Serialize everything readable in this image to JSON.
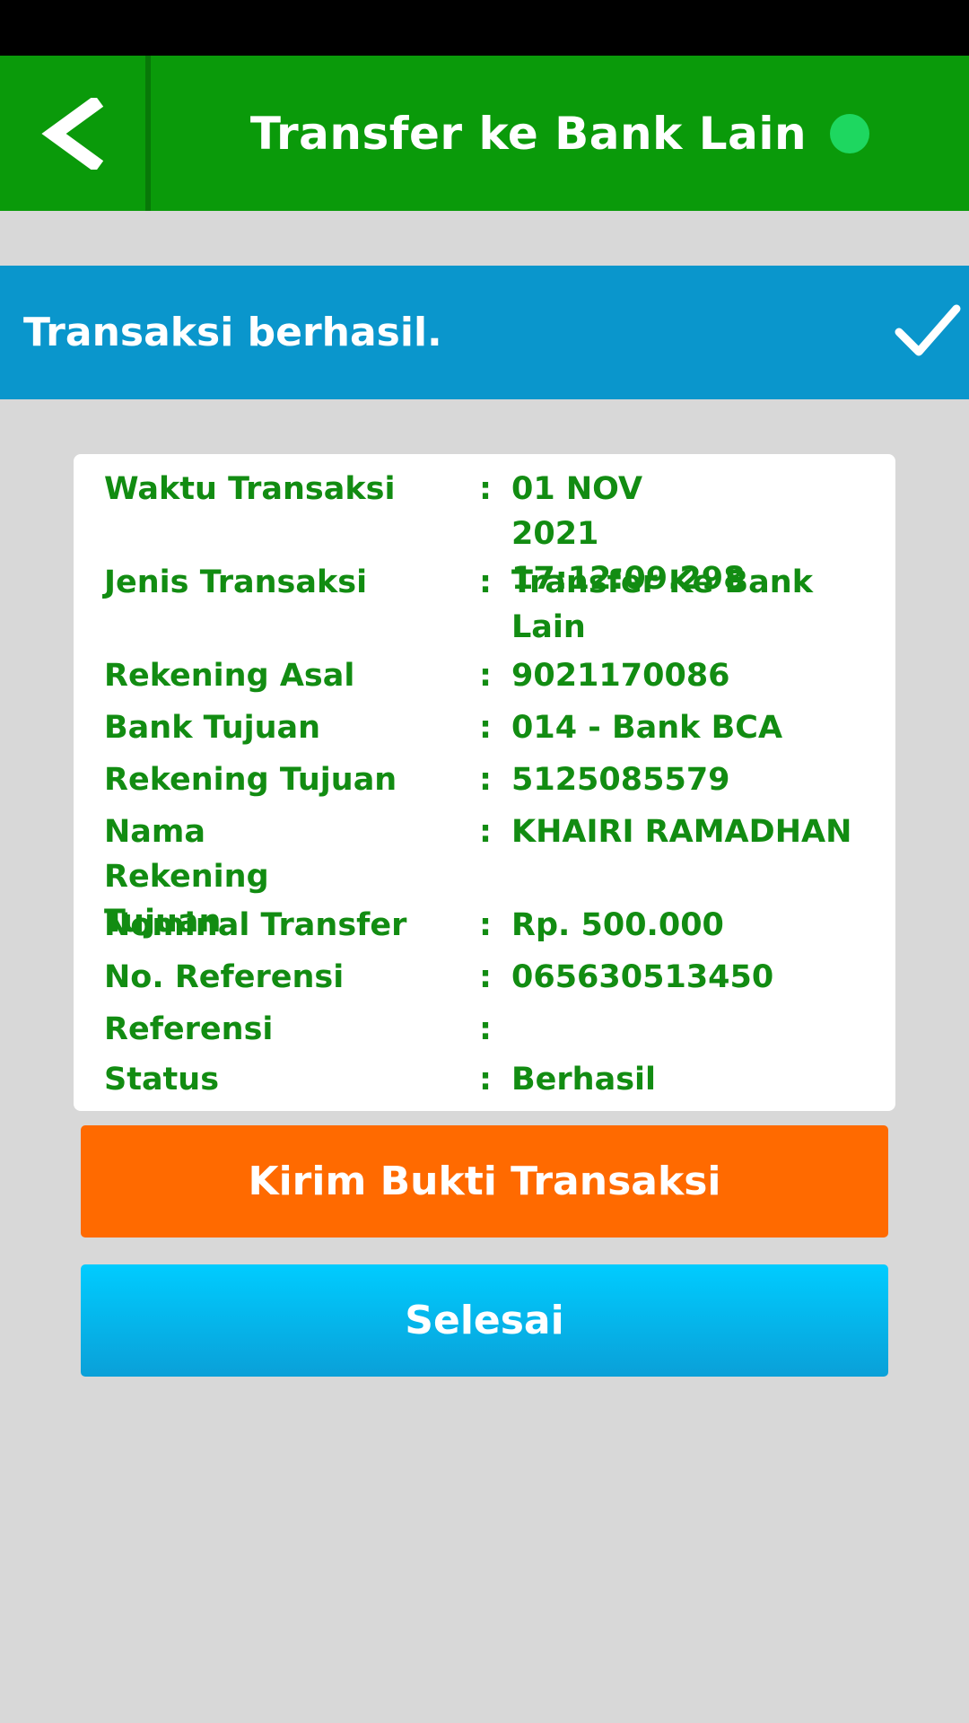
{
  "header": {
    "title": "Transfer ke Bank Lain",
    "back_icon": "chevron-left-icon",
    "status_dot_color": "#1ed760",
    "bar_color": "#0a9a0a"
  },
  "banner": {
    "message": "Transaksi berhasil.",
    "icon": "checkmark-icon",
    "color": "#0a96cc"
  },
  "details": {
    "rows": [
      {
        "label": "Waktu Transaksi",
        "value": "01 NOV 2021 17:12:09.298"
      },
      {
        "label": "Jenis Transaksi",
        "value": "Transfer Ke Bank Lain"
      },
      {
        "label": "Rekening Asal",
        "value": "9021170086"
      },
      {
        "label": "Bank Tujuan",
        "value": "014 - Bank BCA"
      },
      {
        "label": "Rekening Tujuan",
        "value": "5125085579"
      },
      {
        "label": "Nama Rekening Tujuan",
        "value": "KHAIRI RAMADHAN"
      },
      {
        "label": "Nominal Transfer",
        "value": "Rp. 500.000"
      },
      {
        "label": "No. Referensi",
        "value": "065630513450"
      },
      {
        "label": "Referensi",
        "value": ""
      },
      {
        "label": "Status",
        "value": "Berhasil"
      }
    ],
    "separator": ":",
    "text_color": "#128c12"
  },
  "actions": {
    "send_proof_label": "Kirim Bukti Transaksi",
    "send_proof_color": "#ff6a00",
    "done_label": "Selesai",
    "done_color": "#00ccff"
  }
}
